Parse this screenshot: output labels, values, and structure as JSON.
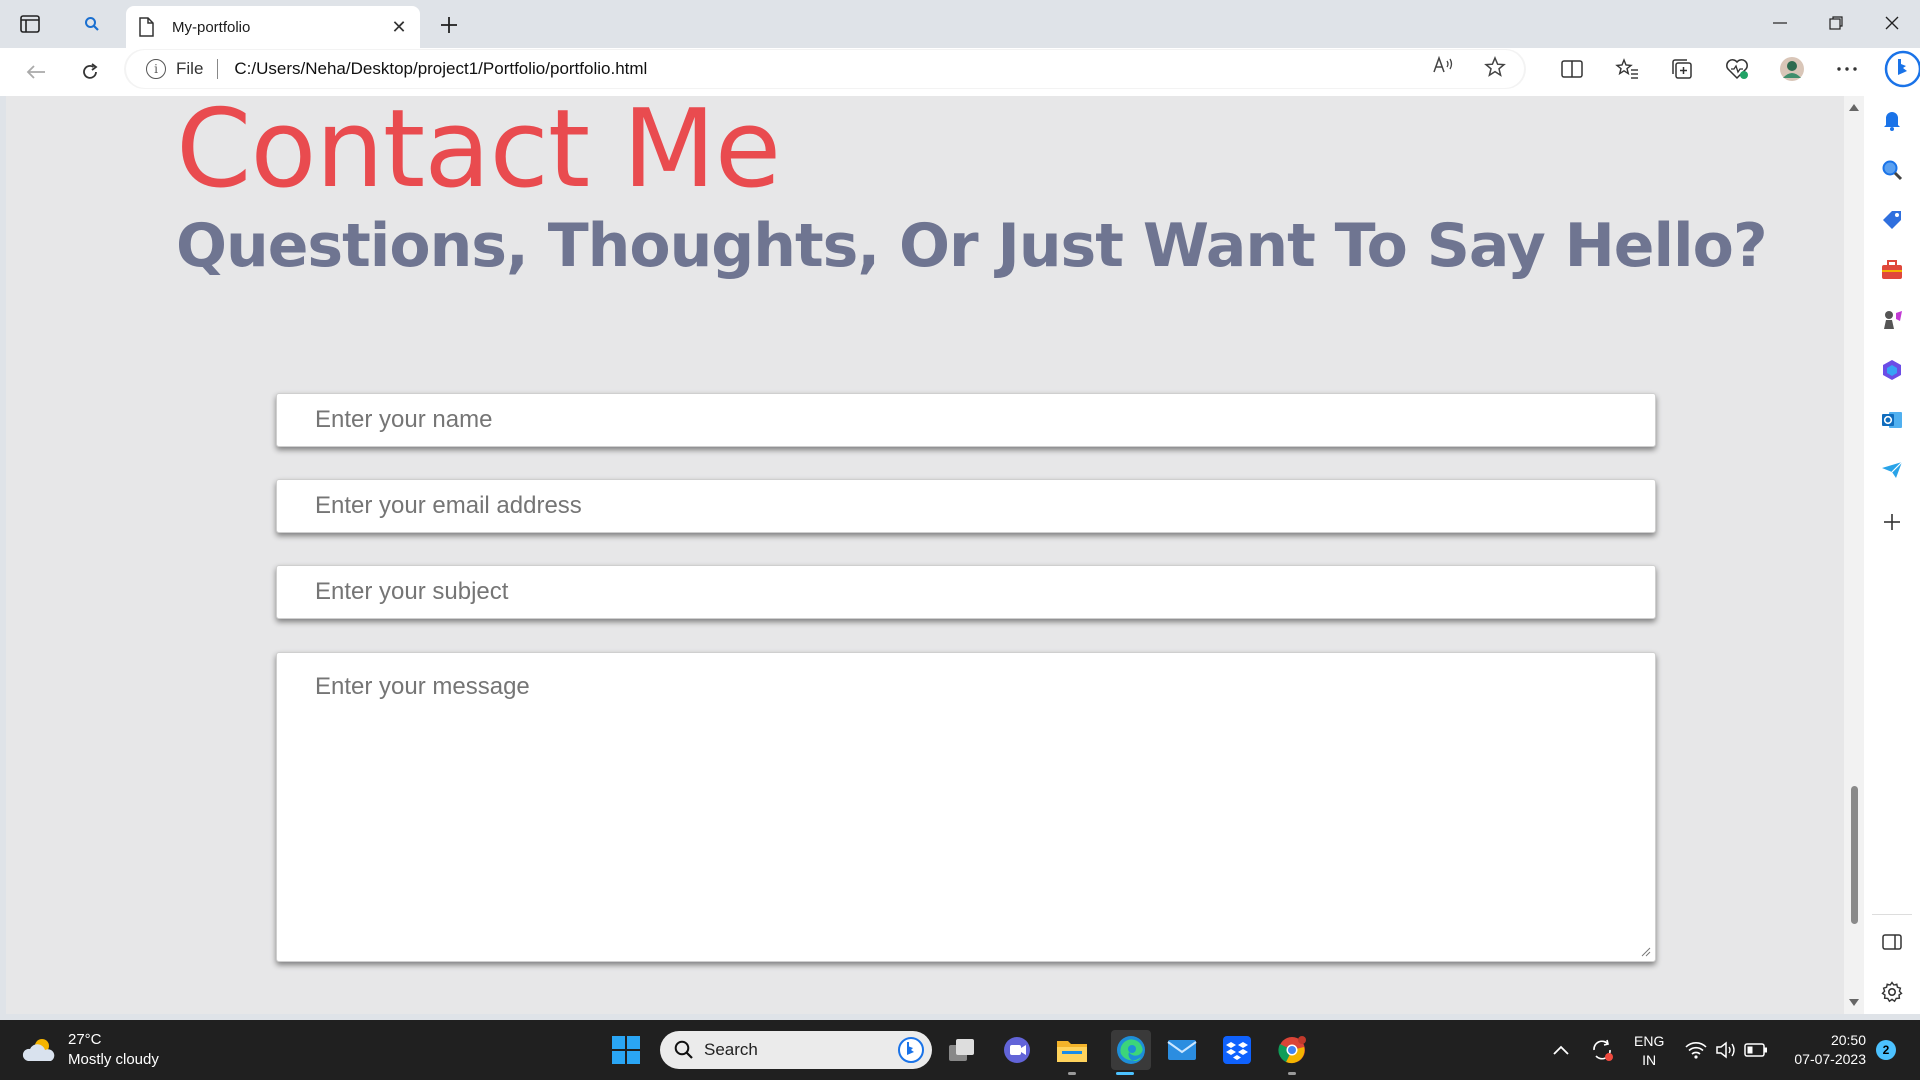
{
  "browser": {
    "tab": {
      "title": "My-portfolio"
    },
    "address": {
      "scheme_label": "File",
      "url": "C:/Users/Neha/Desktop/project1/Portfolio/portfolio.html"
    }
  },
  "page": {
    "title": "Contact Me",
    "subtitle": "Questions, Thoughts, Or Just Want To Say Hello?",
    "form": {
      "name_placeholder": "Enter your name",
      "email_placeholder": "Enter your email address",
      "subject_placeholder": "Enter your subject",
      "message_placeholder": "Enter your message"
    },
    "colors": {
      "title": "#e94b4f",
      "subtitle": "#6f7591",
      "background": "#e7e7e8"
    }
  },
  "taskbar": {
    "weather": {
      "temperature": "27°C",
      "condition": "Mostly cloudy"
    },
    "search_placeholder": "Search",
    "language": {
      "line1": "ENG",
      "line2": "IN"
    },
    "clock": {
      "time": "20:50",
      "date": "07-07-2023"
    },
    "notification_count": "2"
  }
}
